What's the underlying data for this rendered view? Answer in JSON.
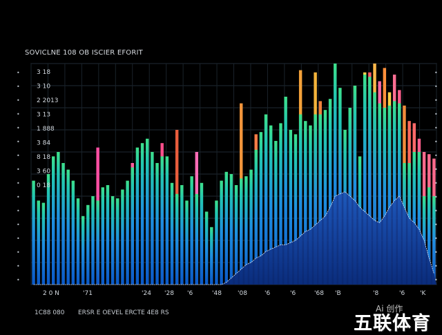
{
  "chart_data": {
    "type": "bar",
    "title": "SOVICLNE 108 OB ISCIER EFORIT",
    "ylabel_ticks": [
      "3 18",
      "3 10",
      "2 2013",
      "3 13",
      "1 888",
      "3 84",
      "8 18",
      "3 60",
      "0 18"
    ],
    "xlabel_ticks": [
      "2 0 N",
      "'71",
      "'24",
      "'28",
      "'6",
      "'48",
      "'08",
      "'6",
      "'6",
      "'68",
      "'B",
      "'8",
      "'6",
      "'K"
    ],
    "footer_left": "1C88 080",
    "footer_right": "ERSR E OEVEL ERCTE 4E8 RS",
    "ylim": [
      0,
      100
    ],
    "series": [
      {
        "values": [
          47,
          38,
          37,
          50,
          58,
          60,
          55,
          52,
          47,
          39,
          31,
          36,
          40,
          38,
          44,
          45,
          40,
          39,
          43,
          47,
          53,
          62,
          64,
          66,
          60,
          55,
          58,
          58,
          46,
          41,
          45,
          38,
          49,
          41,
          46,
          33,
          26,
          38,
          47,
          51,
          50,
          45,
          48,
          49,
          52,
          61,
          69,
          77,
          72,
          65,
          73,
          85,
          70,
          68,
          77,
          74,
          72,
          77,
          77,
          79,
          84,
          100,
          89,
          70,
          80,
          90,
          58,
          95,
          94,
          87,
          82,
          80,
          81,
          83,
          82,
          55,
          55,
          60,
          60,
          40,
          44,
          40
        ]
      },
      {
        "values": [
          0,
          0,
          0,
          0,
          0,
          0,
          0,
          0,
          0,
          0,
          0,
          0,
          0,
          0,
          0,
          0,
          0,
          0,
          0,
          0,
          0,
          0,
          0,
          0,
          0,
          0,
          0,
          0,
          0,
          0,
          0,
          0,
          0,
          0,
          0,
          0,
          0,
          0,
          0,
          1,
          3,
          5,
          7,
          9,
          10,
          12,
          13,
          15,
          16,
          17,
          18,
          18,
          19,
          20,
          22,
          24,
          25,
          27,
          29,
          31,
          35,
          40,
          41,
          42,
          40,
          38,
          35,
          33,
          31,
          29,
          28,
          31,
          35,
          38,
          40,
          35,
          30,
          28,
          25,
          20,
          12,
          5
        ]
      }
    ],
    "highlights": [
      {
        "index": 13,
        "value": 62,
        "color": "#ff4fa3"
      },
      {
        "index": 20,
        "value": 55,
        "color": "#ff5d9c"
      },
      {
        "index": 26,
        "value": 64,
        "color": "#ff4f8c"
      },
      {
        "index": 29,
        "value": 70,
        "color": "#e85d3c"
      },
      {
        "index": 33,
        "value": 60,
        "color": "#ff6cb7"
      },
      {
        "index": 42,
        "value": 82,
        "color": "#f2953b"
      },
      {
        "index": 45,
        "value": 68,
        "color": "#ff7d47"
      },
      {
        "index": 48,
        "value": 63,
        "color": "#ff6e43"
      },
      {
        "index": 54,
        "value": 97,
        "color": "#f4a23a"
      },
      {
        "index": 57,
        "value": 96,
        "color": "#f5b43b"
      },
      {
        "index": 58,
        "value": 83,
        "color": "#f0823c"
      },
      {
        "index": 62,
        "value": 70,
        "color": "#ff6b49"
      },
      {
        "index": 64,
        "value": 75,
        "color": "#ff6547"
      },
      {
        "index": 65,
        "value": 90,
        "color": "#f0a23b"
      },
      {
        "index": 67,
        "value": 96,
        "color": "#ffd24b"
      },
      {
        "index": 68,
        "value": 96,
        "color": "#ff5c68"
      },
      {
        "index": 69,
        "value": 100,
        "color": "#ffb84b"
      },
      {
        "index": 70,
        "value": 92,
        "color": "#ff6aa3"
      },
      {
        "index": 71,
        "value": 98,
        "color": "#ff8f3a"
      },
      {
        "index": 72,
        "value": 87,
        "color": "#ffd14a"
      },
      {
        "index": 73,
        "value": 95,
        "color": "#ff6e93"
      },
      {
        "index": 74,
        "value": 88,
        "color": "#ff5f8d"
      },
      {
        "index": 75,
        "value": 81,
        "color": "#f28c3b"
      },
      {
        "index": 76,
        "value": 74,
        "color": "#ff6a5c"
      },
      {
        "index": 77,
        "value": 73,
        "color": "#ff6a6a"
      },
      {
        "index": 78,
        "value": 66,
        "color": "#ff5f8c"
      },
      {
        "index": 79,
        "value": 60,
        "color": "#ff6a8c"
      },
      {
        "index": 80,
        "value": 59,
        "color": "#ff6a8c"
      },
      {
        "index": 81,
        "value": 57,
        "color": "#ff6a8c"
      }
    ],
    "grid": true
  },
  "watermark": {
    "line1": "Ai 创作",
    "line2": "五联体育"
  }
}
